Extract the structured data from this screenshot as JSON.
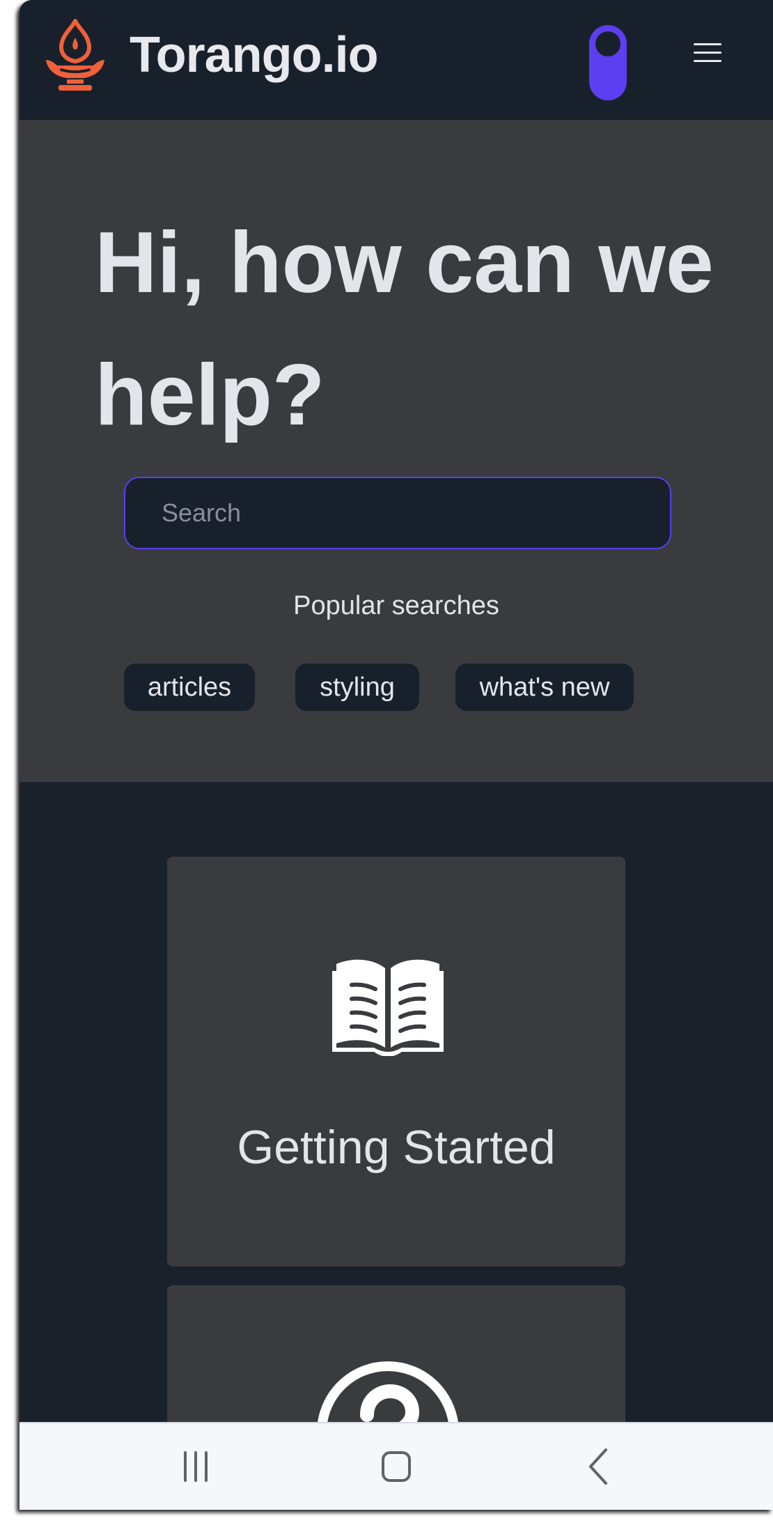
{
  "header": {
    "brand": "Torango.io",
    "logo_icon": "lamp-flame-logo",
    "theme_toggle_icon": "toggle-switch-icon",
    "menu_icon": "hamburger-menu-icon"
  },
  "hero": {
    "title": "Hi, how can we help?",
    "search": {
      "placeholder": "Search",
      "value": ""
    },
    "popular_label": "Popular searches",
    "popular_tags": [
      "articles",
      "styling",
      "what's new"
    ]
  },
  "cards": [
    {
      "title": "Getting Started",
      "icon": "open-book-icon"
    },
    {
      "title": "",
      "icon": "question-circle-icon"
    }
  ],
  "system_nav": {
    "recents_icon": "recents-icon",
    "home_icon": "home-icon",
    "back_icon": "back-icon"
  },
  "colors": {
    "accent": "#5b3ff0",
    "brand_orange": "#f0603a",
    "navbar_bg": "#18212b",
    "hero_bg": "#3a3b3e",
    "text": "#e4e5ea"
  }
}
